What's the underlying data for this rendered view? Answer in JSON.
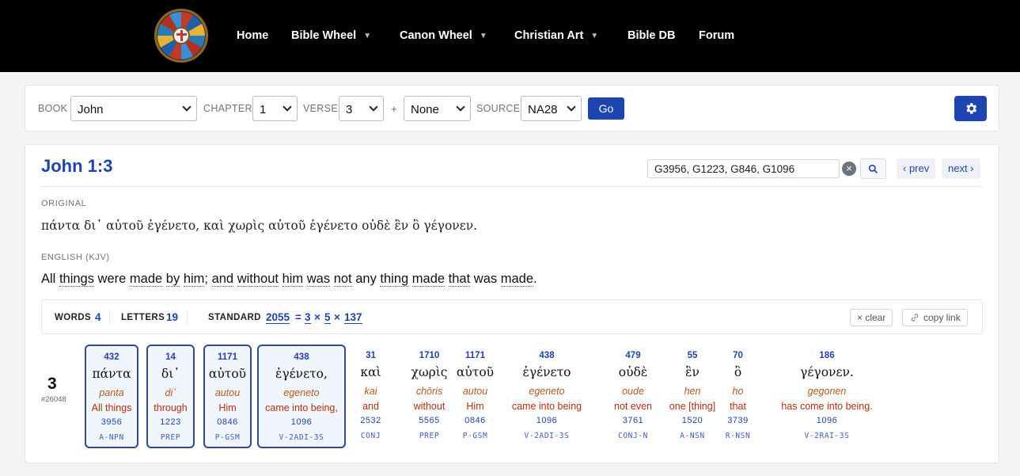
{
  "nav": {
    "items": [
      {
        "label": "Home",
        "dropdown": false
      },
      {
        "label": "Bible Wheel",
        "dropdown": true
      },
      {
        "label": "Canon Wheel",
        "dropdown": true
      },
      {
        "label": "Christian Art",
        "dropdown": true
      },
      {
        "label": "Bible DB",
        "dropdown": false
      },
      {
        "label": "Forum",
        "dropdown": false
      }
    ],
    "caret": "▼"
  },
  "selector": {
    "book_label": "BOOK",
    "book_value": "John",
    "chapter_label": "CHAPTER",
    "chapter_value": "1",
    "verse_label": "VERSE",
    "verse_value": "3",
    "plus": "+",
    "range_value": "None",
    "source_label": "SOURCE",
    "source_value": "NA28",
    "go_label": "Go",
    "settings_icon": "gear-icon"
  },
  "verse": {
    "reference": "John 1:3",
    "search_value": "G3956, G1223, G846, G1096",
    "clear_symbol": "×",
    "prev_label": "‹ prev",
    "next_label": "next ›",
    "original_label": "ORIGINAL",
    "original_text": "πάντα δι᾽ αὐτοῦ ἐγένετο, καὶ χωρὶς αὐτοῦ ἐγένετο οὐδὲ ἓν ὃ γέγονεν.",
    "english_label": "ENGLISH (KJV)",
    "english_words": [
      {
        "t": "All",
        "u": false
      },
      {
        "t": " ",
        "u": false
      },
      {
        "t": "things",
        "u": true
      },
      {
        "t": " were ",
        "u": false
      },
      {
        "t": "made",
        "u": true
      },
      {
        "t": " ",
        "u": false
      },
      {
        "t": "by",
        "u": true
      },
      {
        "t": " ",
        "u": false
      },
      {
        "t": "him",
        "u": true
      },
      {
        "t": "; ",
        "u": false
      },
      {
        "t": "and",
        "u": true
      },
      {
        "t": " ",
        "u": false
      },
      {
        "t": "without",
        "u": true
      },
      {
        "t": " ",
        "u": false
      },
      {
        "t": "him",
        "u": true
      },
      {
        "t": " ",
        "u": false
      },
      {
        "t": "was",
        "u": true
      },
      {
        "t": " ",
        "u": false
      },
      {
        "t": "not",
        "u": true
      },
      {
        "t": " any ",
        "u": false
      },
      {
        "t": "thing",
        "u": true
      },
      {
        "t": " ",
        "u": false
      },
      {
        "t": "made",
        "u": true
      },
      {
        "t": " ",
        "u": false
      },
      {
        "t": "that",
        "u": true
      },
      {
        "t": " was ",
        "u": false
      },
      {
        "t": "made",
        "u": true
      },
      {
        "t": ".",
        "u": false
      }
    ]
  },
  "stats": {
    "words_label": "WORDS",
    "words_value": "4",
    "letters_label": "LETTERS",
    "letters_value": "19",
    "standard_label": "STANDARD",
    "standard_value": "2055",
    "eq": "=",
    "factors": [
      "3",
      "5",
      "137"
    ],
    "times": "×",
    "clear_label": "× clear",
    "copy_label": "copy link"
  },
  "verse_number": "3",
  "verse_id": "#26048",
  "words": [
    {
      "gv": "432",
      "greek": "πάντα",
      "translit": "panta",
      "english": "All things",
      "strongs": "3956",
      "parse": "A-NPN",
      "selected": true
    },
    {
      "gv": "14",
      "greek": "δι᾽",
      "translit": "di᾽",
      "english": "through",
      "strongs": "1223",
      "parse": "PREP",
      "selected": true
    },
    {
      "gv": "1171",
      "greek": "αὐτοῦ",
      "translit": "autou",
      "english": "Him",
      "strongs": "0846",
      "parse": "P-GSM",
      "selected": true
    },
    {
      "gv": "438",
      "greek": "ἐγένετο,",
      "translit": "egeneto",
      "english": "came into being,",
      "strongs": "1096",
      "parse": "V-2ADI-3S",
      "selected": true
    },
    {
      "gv": "31",
      "greek": "καὶ",
      "translit": "kai",
      "english": "and",
      "strongs": "2532",
      "parse": "CONJ",
      "selected": false
    },
    {
      "gv": "1710",
      "greek": "χωρὶς",
      "translit": "chōris",
      "english": "without",
      "strongs": "5565",
      "parse": "PREP",
      "selected": false
    },
    {
      "gv": "1171",
      "greek": "αὐτοῦ",
      "translit": "autou",
      "english": "Him",
      "strongs": "0846",
      "parse": "P-GSM",
      "selected": false
    },
    {
      "gv": "438",
      "greek": "ἐγένετο",
      "translit": "egeneto",
      "english": "came into being",
      "strongs": "1096",
      "parse": "V-2ADI-3S",
      "selected": false
    },
    {
      "gv": "479",
      "greek": "οὐδὲ",
      "translit": "oude",
      "english": "not even",
      "strongs": "3761",
      "parse": "CONJ-N",
      "selected": false
    },
    {
      "gv": "55",
      "greek": "ἓν",
      "translit": "hen",
      "english": "one [thing]",
      "strongs": "1520",
      "parse": "A-NSN",
      "selected": false
    },
    {
      "gv": "70",
      "greek": "ὃ",
      "translit": "ho",
      "english": "that",
      "strongs": "3739",
      "parse": "R-NSN",
      "selected": false
    },
    {
      "gv": "186",
      "greek": "γέγονεν.",
      "translit": "gegonen",
      "english": "has come into being.",
      "strongs": "1096",
      "parse": "V-2RAI-3S",
      "selected": false
    }
  ]
}
